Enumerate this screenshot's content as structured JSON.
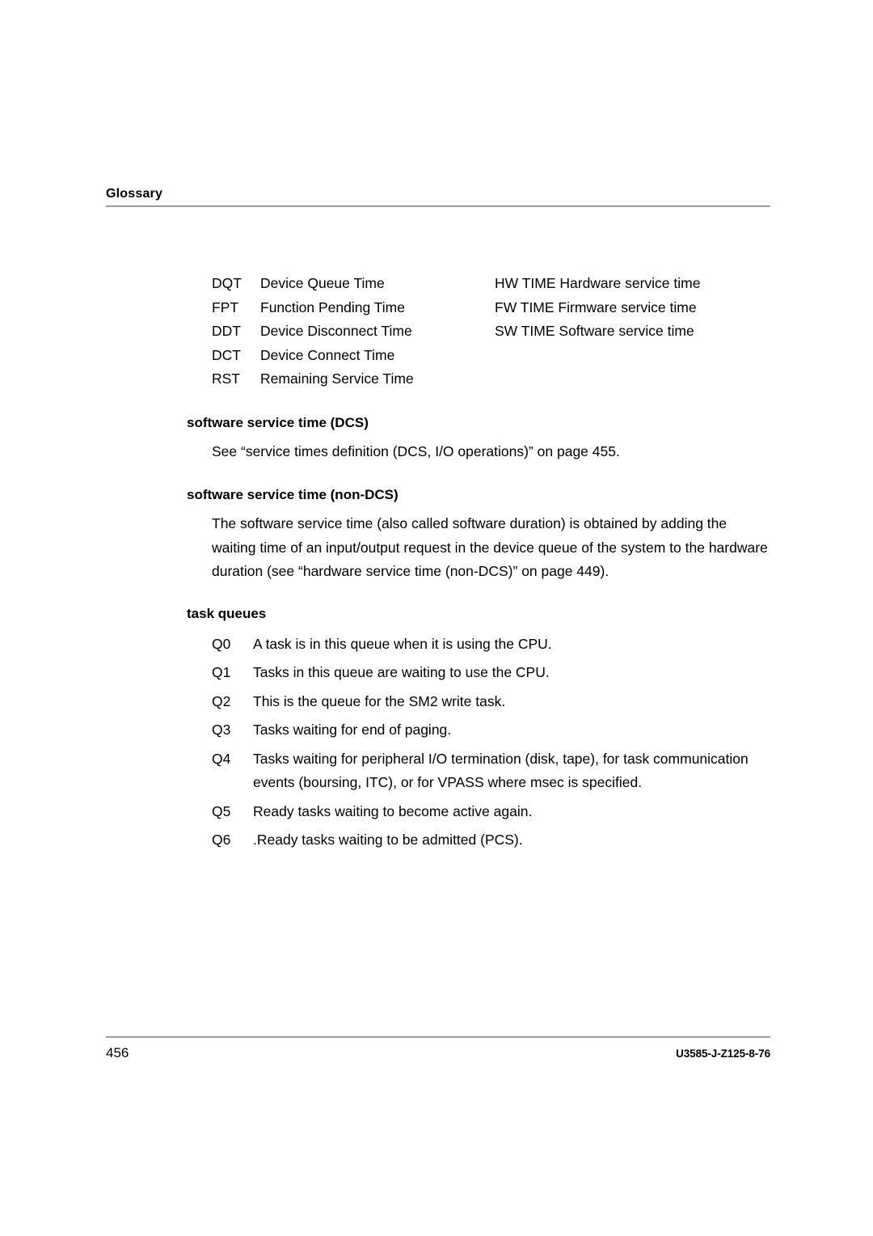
{
  "header": {
    "title": "Glossary"
  },
  "abbreviations": [
    {
      "code": "DQT",
      "desc": "Device Queue Time",
      "right": "HW TIME Hardware service time"
    },
    {
      "code": "FPT",
      "desc": "Function Pending Time",
      "right": "FW TIME Firmware service time"
    },
    {
      "code": "DDT",
      "desc": "Device Disconnect Time",
      "right": "SW TIME Software service time"
    },
    {
      "code": "DCT",
      "desc": "Device Connect Time",
      "right": ""
    },
    {
      "code": "RST",
      "desc": "Remaining Service Time",
      "right": ""
    }
  ],
  "entries": {
    "software_service_time_dcs": {
      "term": "software service time (DCS)",
      "body": "See “service times definition (DCS, I/O operations)” on page 455."
    },
    "software_service_time_non_dcs": {
      "term": "software service time (non-DCS)",
      "body": "The software service time (also called software duration) is obtained by adding the waiting time of an input/output request in the device queue of the system to the hardware duration (see “hardware service time (non-DCS)” on page 449)."
    },
    "task_queues": {
      "term": "task queues",
      "items": [
        {
          "label": "Q0",
          "text": "A task is in this queue when it is using the CPU."
        },
        {
          "label": "Q1",
          "text": "Tasks in this queue are waiting to use the CPU."
        },
        {
          "label": "Q2",
          "text": "This is the queue for the SM2 write task."
        },
        {
          "label": "Q3",
          "text": "Tasks waiting for end of paging."
        },
        {
          "label": "Q4",
          "text": "Tasks waiting for peripheral I/O termination (disk, tape), for task communication events (boursing, ITC), or for VPASS where msec is specified."
        },
        {
          "label": "Q5",
          "text": "Ready tasks waiting to become active again."
        },
        {
          "label": "Q6",
          "text": ".Ready tasks waiting to be admitted (PCS)."
        }
      ]
    }
  },
  "footer": {
    "page_number": "456",
    "document_id": "U3585-J-Z125-8-76"
  },
  "colors": {
    "rule": "#9a9a9a",
    "text": "#000000",
    "background": "#ffffff"
  }
}
